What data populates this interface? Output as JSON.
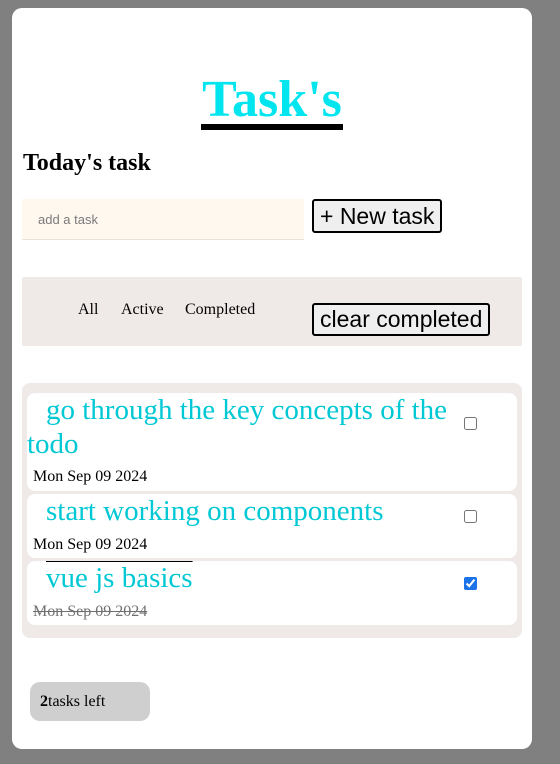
{
  "app": {
    "title": "Task's",
    "section_title": "Today's task"
  },
  "input": {
    "placeholder": "add a task",
    "value": ""
  },
  "buttons": {
    "new_task": "+ New task",
    "clear_completed": "clear completed"
  },
  "filters": [
    "All",
    "Active",
    "Completed"
  ],
  "tasks": [
    {
      "text": "go through the key concepts of the todo",
      "date": "Mon Sep 09 2024",
      "completed": false
    },
    {
      "text": "start working on components",
      "date": "Mon Sep 09 2024",
      "completed": false
    },
    {
      "text": "vue js basics",
      "date": "Mon Sep 09 2024",
      "completed": true
    }
  ],
  "footer": {
    "count": "2",
    "label": "tasks left"
  },
  "colors": {
    "accent": "#00e5ee",
    "task_text": "#00c8d4",
    "checkbox": "#1a73e8"
  }
}
